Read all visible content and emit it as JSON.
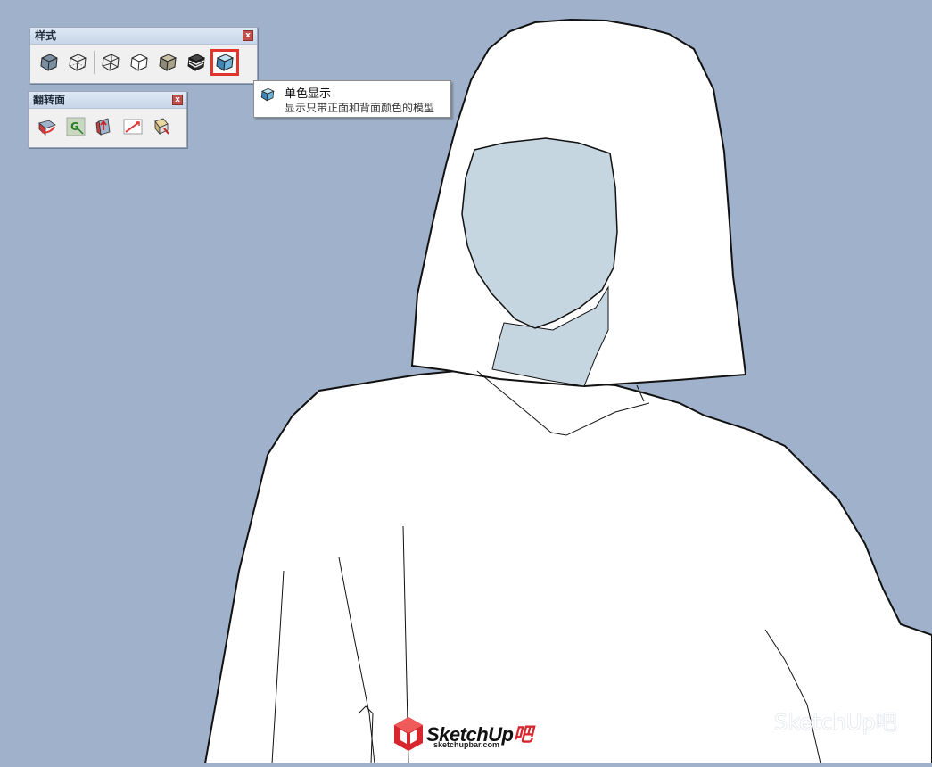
{
  "palettes": {
    "styles": {
      "title": "样式",
      "close_label": "x",
      "tools": [
        {
          "name": "xray",
          "icon": "xray-cube-icon"
        },
        {
          "name": "back-edges",
          "icon": "back-edges-cube-icon"
        },
        {
          "name": "wireframe",
          "icon": "wireframe-cube-icon"
        },
        {
          "name": "hidden-line",
          "icon": "hidden-line-cube-icon"
        },
        {
          "name": "shaded",
          "icon": "shaded-cube-icon"
        },
        {
          "name": "shaded-with-textures",
          "icon": "textured-cube-icon"
        },
        {
          "name": "monochrome",
          "icon": "monochrome-cube-icon",
          "active": true
        }
      ]
    },
    "reverse_faces": {
      "title": "翻转面",
      "close_label": "x",
      "tools": [
        {
          "name": "reverse-faces",
          "icon": "reverse-faces-icon"
        },
        {
          "name": "select-group",
          "icon": "group-select-icon",
          "glyph": "G"
        },
        {
          "name": "orient-faces",
          "icon": "orient-faces-icon"
        },
        {
          "name": "measure",
          "icon": "measure-icon"
        },
        {
          "name": "paint-fix",
          "icon": "paint-bucket-icon"
        }
      ]
    }
  },
  "tooltip": {
    "title": "单色显示",
    "description": "显示只带正面和背面颜色的模型",
    "icon": "monochrome-cube-icon"
  },
  "branding": {
    "logo_text": "SketchUp",
    "logo_suffix": "吧",
    "logo_url_text": "sketchupbar.com",
    "watermark_text": "SketchUp吧",
    "watermark_icon": "wechat-icon"
  },
  "colors": {
    "background": "#a0b2cb",
    "model_front_face": "#ffffff",
    "model_back_face": "#c6d6e0",
    "active_highlight": "#e0352d"
  }
}
